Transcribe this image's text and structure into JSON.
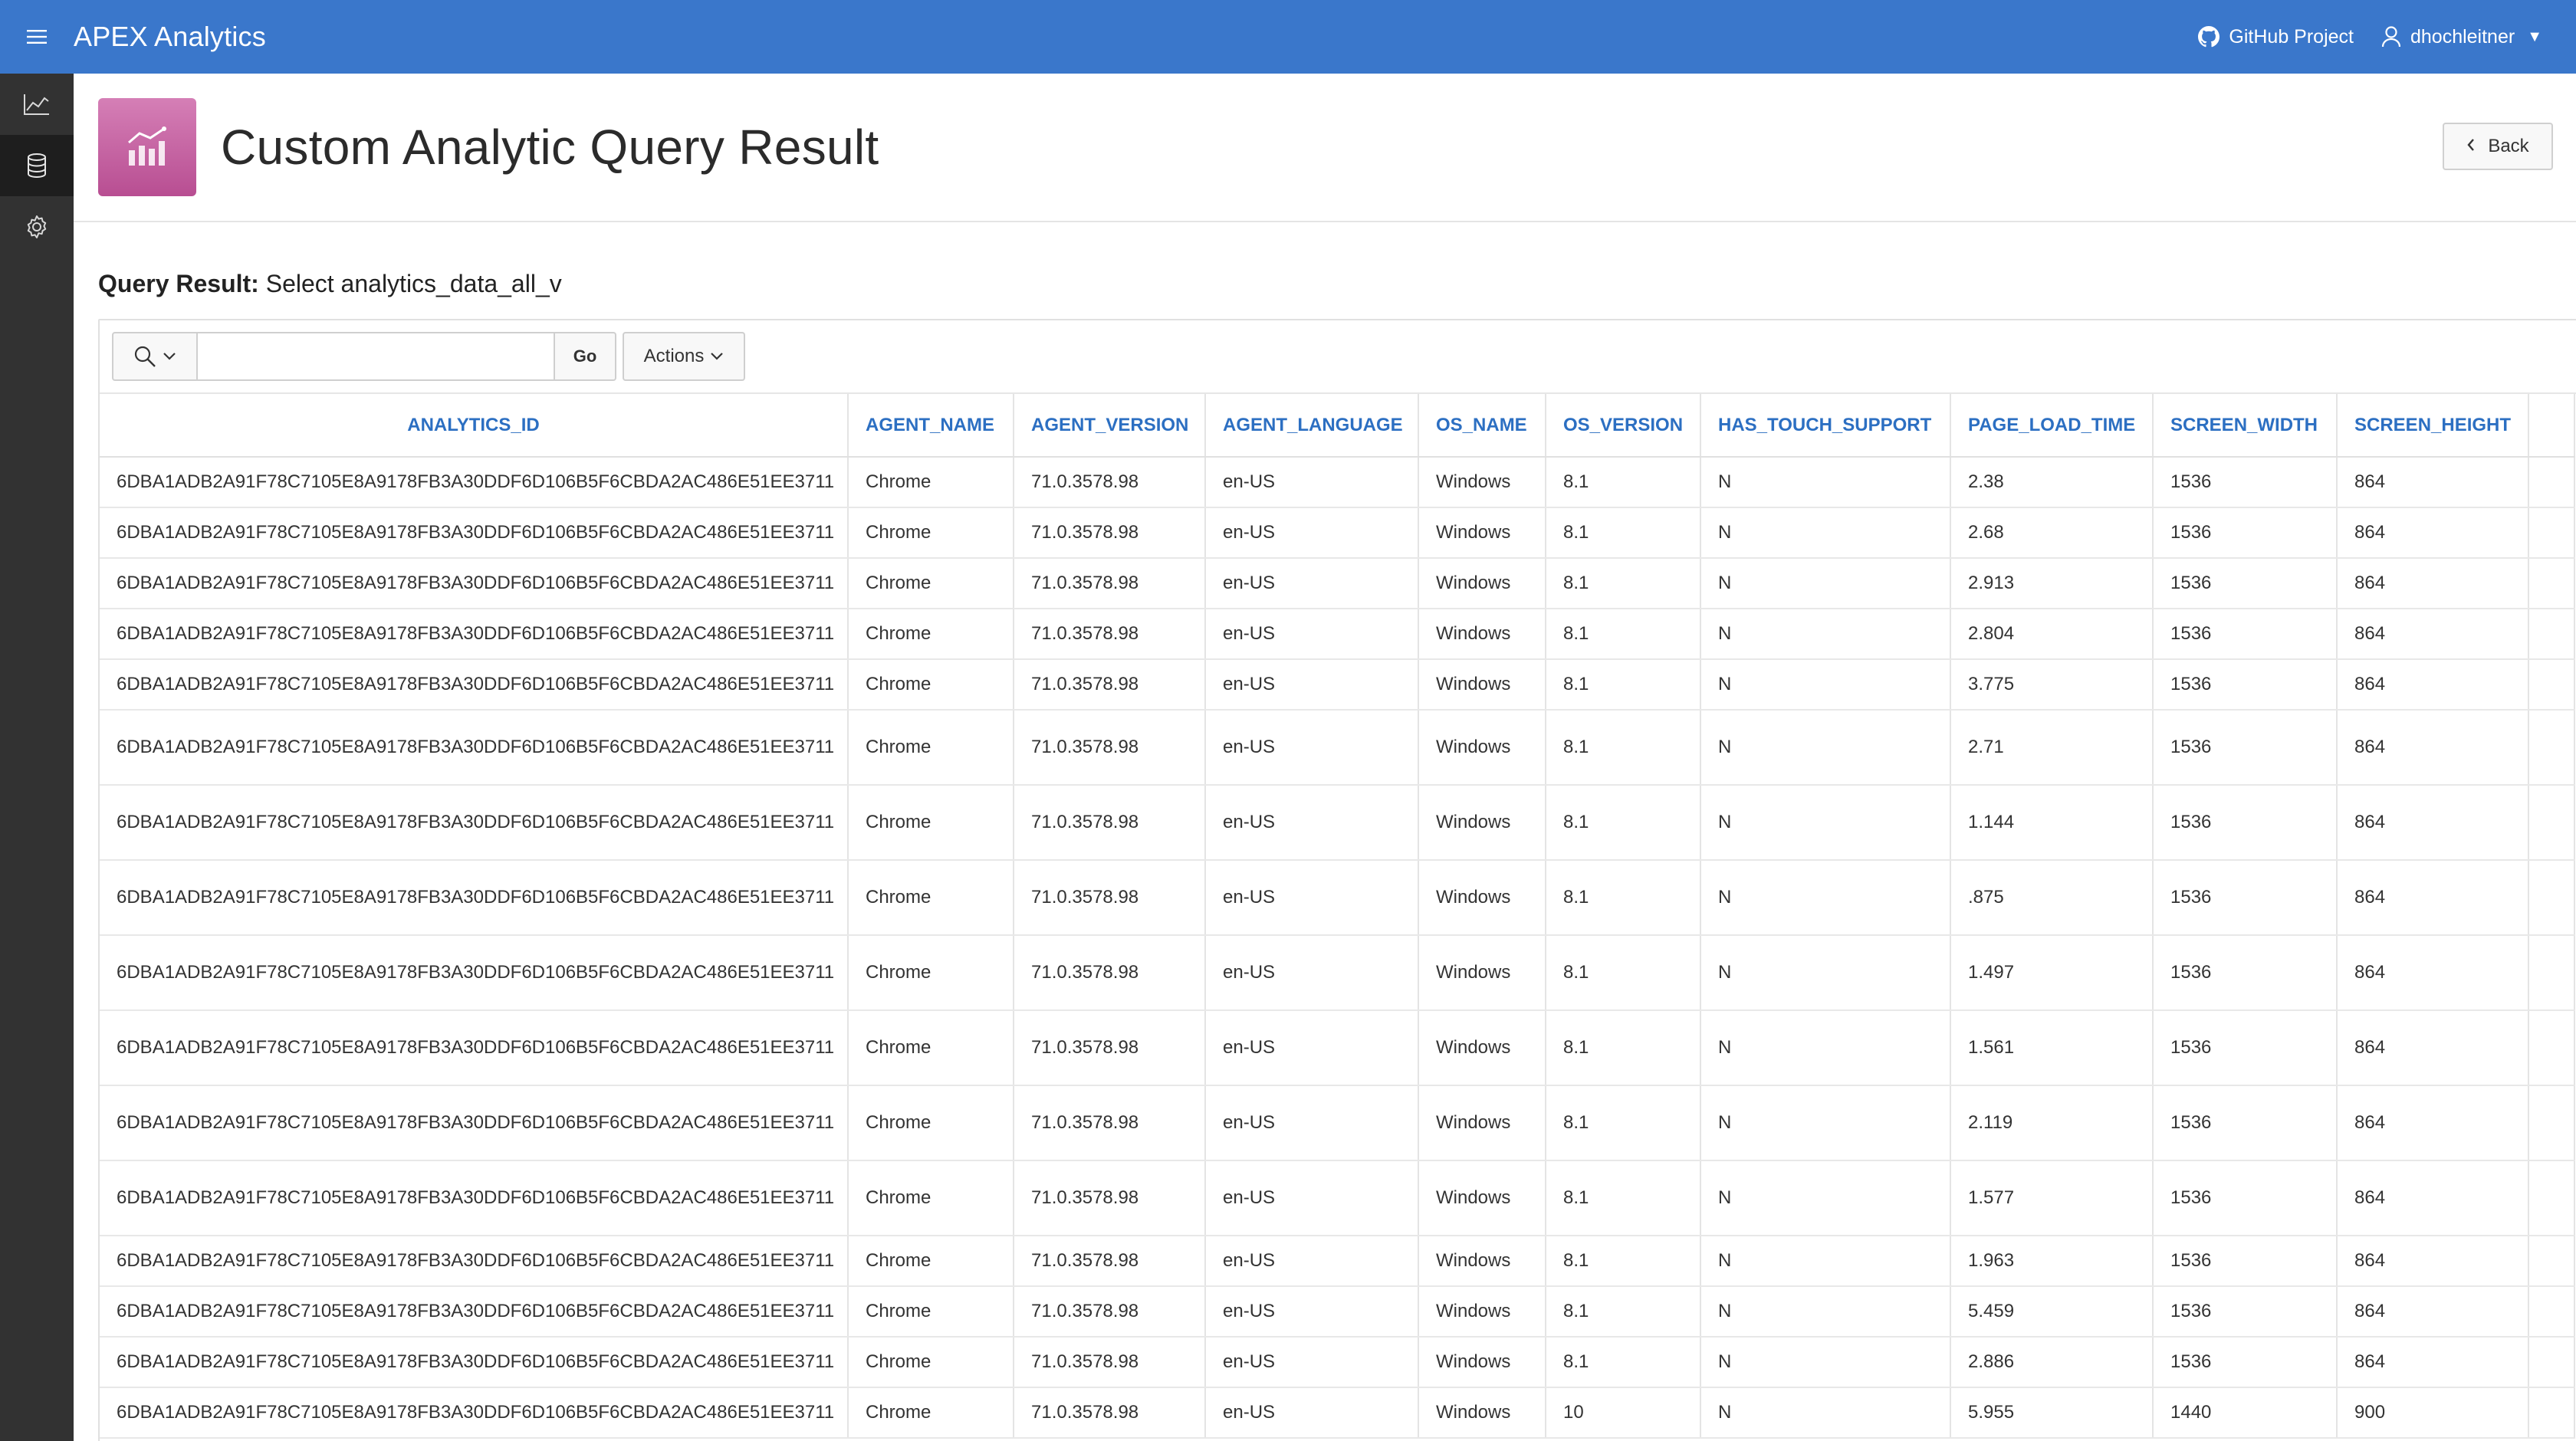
{
  "header": {
    "app_title": "APEX Analytics",
    "github_label": "GitHub Project",
    "user_label": "dhochleitner"
  },
  "sidebar": {
    "items": [
      {
        "icon": "line-chart-icon"
      },
      {
        "icon": "database-icon",
        "active": true
      },
      {
        "icon": "gear-icon"
      }
    ]
  },
  "page": {
    "title": "Custom Analytic Query Result",
    "back_label": "Back"
  },
  "region": {
    "title_bold": "Query Result:",
    "title_rest": "Select analytics_data_all_v"
  },
  "toolbar": {
    "search_value": "",
    "go_label": "Go",
    "actions_label": "Actions"
  },
  "table": {
    "columns": [
      "ANALYTICS_ID",
      "AGENT_NAME",
      "AGENT_VERSION",
      "AGENT_LANGUAGE",
      "OS_NAME",
      "OS_VERSION",
      "HAS_TOUCH_SUPPORT",
      "PAGE_LOAD_TIME",
      "SCREEN_WIDTH",
      "SCREEN_HEIGHT"
    ],
    "rows": [
      [
        "6DBA1ADB2A91F78C7105E8A9178FB3A30DDF6D106B5F6CBDA2AC486E51EE3711",
        "Chrome",
        "71.0.3578.98",
        "en-US",
        "Windows",
        "8.1",
        "N",
        "2.38",
        "1536",
        "864"
      ],
      [
        "6DBA1ADB2A91F78C7105E8A9178FB3A30DDF6D106B5F6CBDA2AC486E51EE3711",
        "Chrome",
        "71.0.3578.98",
        "en-US",
        "Windows",
        "8.1",
        "N",
        "2.68",
        "1536",
        "864"
      ],
      [
        "6DBA1ADB2A91F78C7105E8A9178FB3A30DDF6D106B5F6CBDA2AC486E51EE3711",
        "Chrome",
        "71.0.3578.98",
        "en-US",
        "Windows",
        "8.1",
        "N",
        "2.913",
        "1536",
        "864"
      ],
      [
        "6DBA1ADB2A91F78C7105E8A9178FB3A30DDF6D106B5F6CBDA2AC486E51EE3711",
        "Chrome",
        "71.0.3578.98",
        "en-US",
        "Windows",
        "8.1",
        "N",
        "2.804",
        "1536",
        "864"
      ],
      [
        "6DBA1ADB2A91F78C7105E8A9178FB3A30DDF6D106B5F6CBDA2AC486E51EE3711",
        "Chrome",
        "71.0.3578.98",
        "en-US",
        "Windows",
        "8.1",
        "N",
        "3.775",
        "1536",
        "864"
      ],
      [
        "6DBA1ADB2A91F78C7105E8A9178FB3A30DDF6D106B5F6CBDA2AC486E51EE3711",
        "Chrome",
        "71.0.3578.98",
        "en-US",
        "Windows",
        "8.1",
        "N",
        "2.71",
        "1536",
        "864"
      ],
      [
        "6DBA1ADB2A91F78C7105E8A9178FB3A30DDF6D106B5F6CBDA2AC486E51EE3711",
        "Chrome",
        "71.0.3578.98",
        "en-US",
        "Windows",
        "8.1",
        "N",
        "1.144",
        "1536",
        "864"
      ],
      [
        "6DBA1ADB2A91F78C7105E8A9178FB3A30DDF6D106B5F6CBDA2AC486E51EE3711",
        "Chrome",
        "71.0.3578.98",
        "en-US",
        "Windows",
        "8.1",
        "N",
        ".875",
        "1536",
        "864"
      ],
      [
        "6DBA1ADB2A91F78C7105E8A9178FB3A30DDF6D106B5F6CBDA2AC486E51EE3711",
        "Chrome",
        "71.0.3578.98",
        "en-US",
        "Windows",
        "8.1",
        "N",
        "1.497",
        "1536",
        "864"
      ],
      [
        "6DBA1ADB2A91F78C7105E8A9178FB3A30DDF6D106B5F6CBDA2AC486E51EE3711",
        "Chrome",
        "71.0.3578.98",
        "en-US",
        "Windows",
        "8.1",
        "N",
        "1.561",
        "1536",
        "864"
      ],
      [
        "6DBA1ADB2A91F78C7105E8A9178FB3A30DDF6D106B5F6CBDA2AC486E51EE3711",
        "Chrome",
        "71.0.3578.98",
        "en-US",
        "Windows",
        "8.1",
        "N",
        "2.119",
        "1536",
        "864"
      ],
      [
        "6DBA1ADB2A91F78C7105E8A9178FB3A30DDF6D106B5F6CBDA2AC486E51EE3711",
        "Chrome",
        "71.0.3578.98",
        "en-US",
        "Windows",
        "8.1",
        "N",
        "1.577",
        "1536",
        "864"
      ],
      [
        "6DBA1ADB2A91F78C7105E8A9178FB3A30DDF6D106B5F6CBDA2AC486E51EE3711",
        "Chrome",
        "71.0.3578.98",
        "en-US",
        "Windows",
        "8.1",
        "N",
        "1.963",
        "1536",
        "864"
      ],
      [
        "6DBA1ADB2A91F78C7105E8A9178FB3A30DDF6D106B5F6CBDA2AC486E51EE3711",
        "Chrome",
        "71.0.3578.98",
        "en-US",
        "Windows",
        "8.1",
        "N",
        "5.459",
        "1536",
        "864"
      ],
      [
        "6DBA1ADB2A91F78C7105E8A9178FB3A30DDF6D106B5F6CBDA2AC486E51EE3711",
        "Chrome",
        "71.0.3578.98",
        "en-US",
        "Windows",
        "8.1",
        "N",
        "2.886",
        "1536",
        "864"
      ],
      [
        "6DBA1ADB2A91F78C7105E8A9178FB3A30DDF6D106B5F6CBDA2AC486E51EE3711",
        "Chrome",
        "71.0.3578.98",
        "en-US",
        "Windows",
        "10",
        "N",
        "5.955",
        "1440",
        "900"
      ]
    ]
  }
}
